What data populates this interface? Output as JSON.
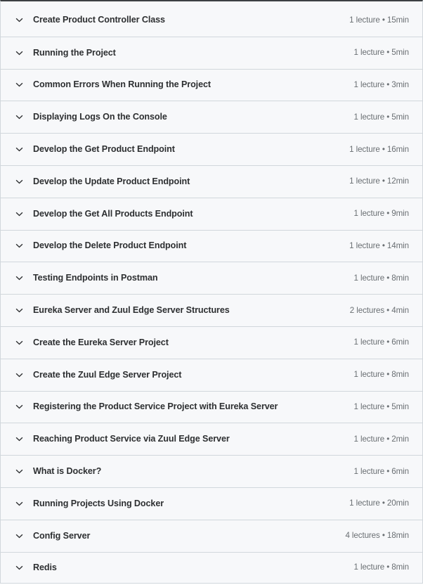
{
  "curriculum": {
    "component": "course-curriculum-accordion",
    "icons": {
      "expand_chevron": "chevron-down-icon"
    },
    "colors": {
      "row_background": "#f7f8fa",
      "divider": "#d1d7dc",
      "title_text": "#2d2f31",
      "meta_text": "#6a6f73",
      "top_edge": "#3c4043"
    },
    "sections": [
      {
        "title": "Create Product Controller Class",
        "meta": "1 lecture • 15min",
        "lectures": 1,
        "duration": "15min"
      },
      {
        "title": "Running the Project",
        "meta": "1 lecture • 5min",
        "lectures": 1,
        "duration": "5min"
      },
      {
        "title": "Common Errors When Running the Project",
        "meta": "1 lecture • 3min",
        "lectures": 1,
        "duration": "3min"
      },
      {
        "title": "Displaying Logs On the Console",
        "meta": "1 lecture • 5min",
        "lectures": 1,
        "duration": "5min"
      },
      {
        "title": "Develop the Get Product Endpoint",
        "meta": "1 lecture • 16min",
        "lectures": 1,
        "duration": "16min"
      },
      {
        "title": "Develop the Update Product Endpoint",
        "meta": "1 lecture • 12min",
        "lectures": 1,
        "duration": "12min"
      },
      {
        "title": "Develop the Get All Products Endpoint",
        "meta": "1 lecture • 9min",
        "lectures": 1,
        "duration": "9min"
      },
      {
        "title": "Develop the Delete Product Endpoint",
        "meta": "1 lecture • 14min",
        "lectures": 1,
        "duration": "14min"
      },
      {
        "title": "Testing Endpoints in Postman",
        "meta": "1 lecture • 8min",
        "lectures": 1,
        "duration": "8min"
      },
      {
        "title": "Eureka Server and Zuul Edge Server Structures",
        "meta": "2 lectures • 4min",
        "lectures": 2,
        "duration": "4min"
      },
      {
        "title": "Create the Eureka Server Project",
        "meta": "1 lecture • 6min",
        "lectures": 1,
        "duration": "6min"
      },
      {
        "title": "Create the Zuul Edge Server Project",
        "meta": "1 lecture • 8min",
        "lectures": 1,
        "duration": "8min"
      },
      {
        "title": "Registering the Product Service Project with Eureka Server",
        "meta": "1 lecture • 5min",
        "lectures": 1,
        "duration": "5min"
      },
      {
        "title": "Reaching Product Service via Zuul Edge Server",
        "meta": "1 lecture • 2min",
        "lectures": 1,
        "duration": "2min"
      },
      {
        "title": "What is Docker?",
        "meta": "1 lecture • 6min",
        "lectures": 1,
        "duration": "6min"
      },
      {
        "title": "Running Projects Using Docker",
        "meta": "1 lecture • 20min",
        "lectures": 1,
        "duration": "20min"
      },
      {
        "title": "Config Server",
        "meta": "4 lectures • 18min",
        "lectures": 4,
        "duration": "18min"
      },
      {
        "title": "Redis",
        "meta": "1 lecture • 8min",
        "lectures": 1,
        "duration": "8min"
      }
    ]
  }
}
